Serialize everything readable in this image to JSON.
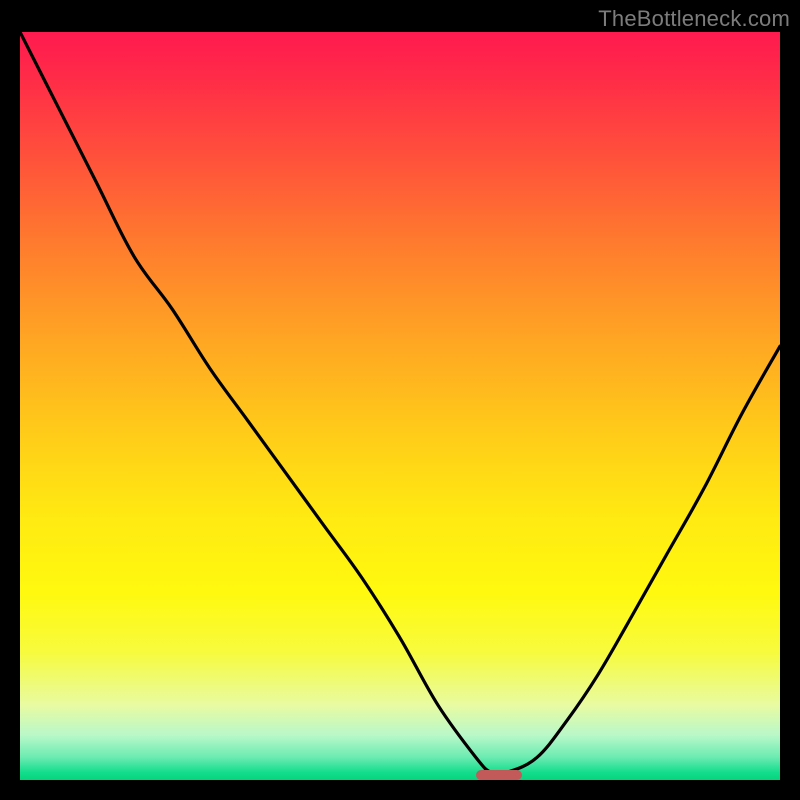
{
  "watermark": {
    "text": "TheBottleneck.com"
  },
  "colors": {
    "frame": "#000000",
    "gradient_stops": [
      "#ff1a4f",
      "#ff2b48",
      "#ff4e3c",
      "#ff7a2e",
      "#ffa224",
      "#ffc71a",
      "#ffe812",
      "#fff90f",
      "#f7fb3e",
      "#e8fba1",
      "#b9f8c9",
      "#6aebb1",
      "#12dd8c",
      "#06d47e"
    ],
    "curve": "#000000",
    "marker": "#c25a5a"
  },
  "chart_data": {
    "type": "line",
    "title": "",
    "xlabel": "",
    "ylabel": "",
    "xlim": [
      0,
      100
    ],
    "ylim": [
      0,
      100
    ],
    "grid": false,
    "legend": false,
    "series": [
      {
        "name": "bottleneck-curve",
        "x": [
          0,
          5,
          10,
          15,
          20,
          25,
          30,
          35,
          40,
          45,
          50,
          55,
          60,
          62,
          64,
          68,
          72,
          76,
          80,
          85,
          90,
          95,
          100
        ],
        "values": [
          100,
          90,
          80,
          70,
          63,
          55,
          48,
          41,
          34,
          27,
          19,
          10,
          3,
          1,
          1,
          3,
          8,
          14,
          21,
          30,
          39,
          49,
          58
        ]
      }
    ],
    "marker": {
      "x_start": 60,
      "x_end": 66,
      "y": 0.7
    }
  }
}
